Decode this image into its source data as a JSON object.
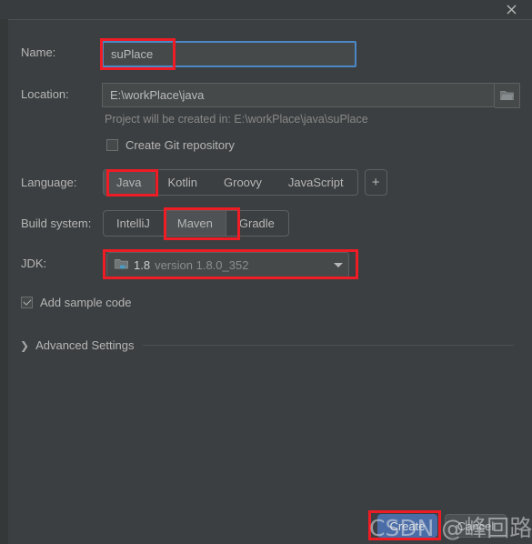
{
  "window": {
    "close_icon": "close-icon"
  },
  "fields": {
    "name": {
      "label": "Name:",
      "value": "suPlace"
    },
    "location": {
      "label": "Location:",
      "value": "E:\\workPlace\\java",
      "browse_icon": "folder-icon"
    },
    "hint": "Project will be created in: E:\\workPlace\\java\\suPlace",
    "git": {
      "label": "Create Git repository",
      "checked": false
    },
    "language": {
      "label": "Language:",
      "options": [
        "Java",
        "Kotlin",
        "Groovy",
        "JavaScript"
      ],
      "selected": "Java",
      "add_label": "+"
    },
    "build_system": {
      "label": "Build system:",
      "options": [
        "IntelliJ",
        "Maven",
        "Gradle"
      ],
      "selected": "Maven"
    },
    "jdk": {
      "label": "JDK:",
      "icon": "java-folder-icon",
      "version": "1.8",
      "version_detail": "version 1.8.0_352"
    },
    "sample_code": {
      "label": "Add sample code",
      "checked": true
    },
    "advanced": {
      "label": "Advanced Settings",
      "chevron": "chevron-right-icon",
      "expanded": false
    }
  },
  "footer": {
    "create_label": "Create",
    "cancel_label": "Cancel"
  },
  "watermark": {
    "text": "CSDN @峰回路转~"
  },
  "colors": {
    "background": "#3c3f41",
    "field_background": "#45494a",
    "accent_focus": "#4a88c7",
    "primary_button": "#4a6da7",
    "annotation": "#ee1c25",
    "text": "#b6b6b6",
    "muted_text": "#888888"
  }
}
